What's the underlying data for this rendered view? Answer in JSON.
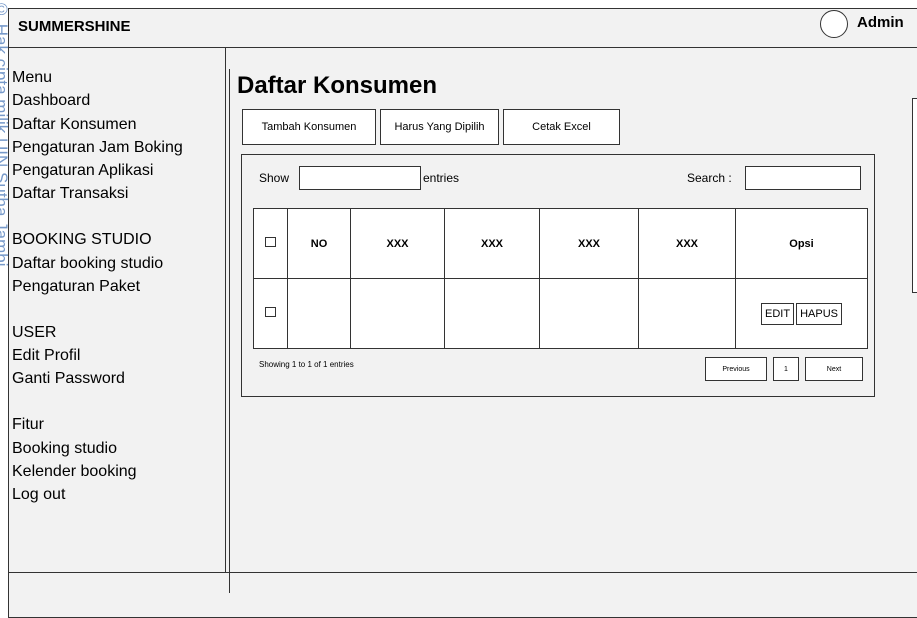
{
  "header": {
    "brand": "SUMMERSHINE",
    "user": "Admin"
  },
  "sidebar": {
    "items": [
      {
        "label": "Menu"
      },
      {
        "label": "Dashboard"
      },
      {
        "label": "Daftar Konsumen"
      },
      {
        "label": "Pengaturan Jam Boking"
      },
      {
        "label": "Pengaturan Aplikasi"
      },
      {
        "label": "Daftar Transaksi"
      },
      {
        "label": "BOOKING STUDIO"
      },
      {
        "label": "Daftar booking studio"
      },
      {
        "label": "Pengaturan Paket"
      },
      {
        "label": "USER"
      },
      {
        "label": "Edit Profil"
      },
      {
        "label": "Ganti Password"
      },
      {
        "label": "Fitur"
      },
      {
        "label": "Booking studio"
      },
      {
        "label": "Kelender booking"
      },
      {
        "label": "Log out"
      }
    ]
  },
  "main": {
    "title": "Daftar Konsumen",
    "toolbar": {
      "add": "Tambah Konsumen",
      "selected": "Harus Yang Dipilih",
      "excel": "Cetak Excel"
    },
    "show_label": "Show",
    "entries_label": "entries",
    "search_label": "Search :",
    "table": {
      "headers": [
        "NO",
        "XXX",
        "XXX",
        "XXX",
        "XXX",
        "Opsi"
      ],
      "row_actions": {
        "edit": "EDIT",
        "delete": "HAPUS"
      }
    },
    "info": "Showing 1 to 1 of 1 entries",
    "pagination": {
      "prev": "Previous",
      "page": "1",
      "next": "Next"
    }
  }
}
